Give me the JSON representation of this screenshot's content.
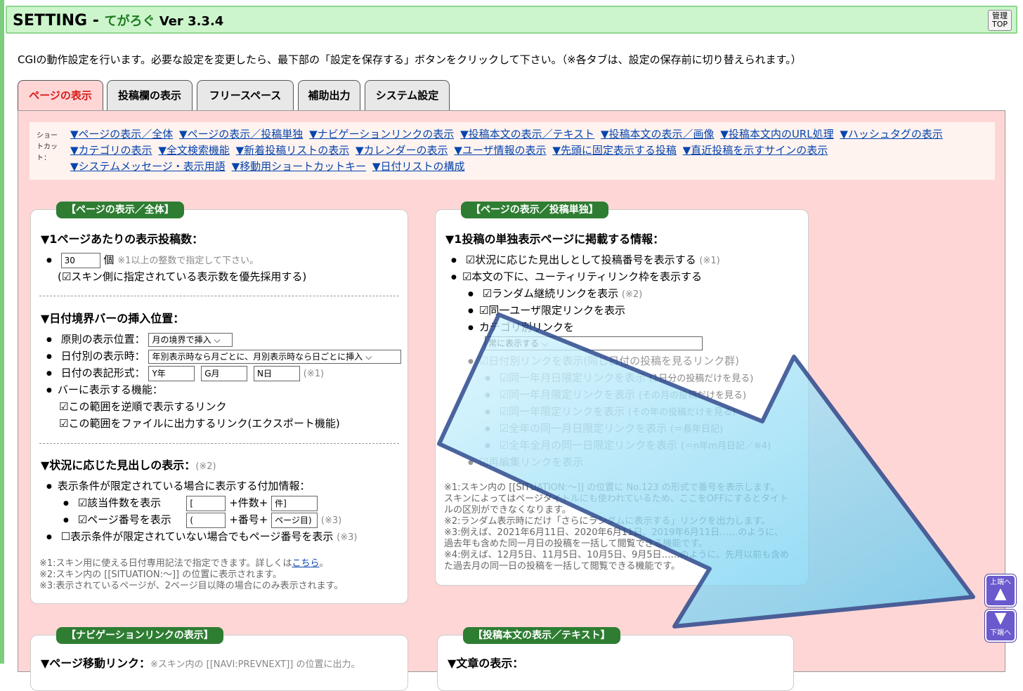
{
  "header": {
    "title_main": "SETTING - ",
    "title_app": "てがろぐ",
    "title_ver": " Ver 3.3.4",
    "admin_btn_line1": "管理",
    "admin_btn_line2": "TOP"
  },
  "intro": "CGIの動作設定を行います。必要な設定を変更したら、最下部の「設定を保存する」ボタンをクリックして下さい。（※各タブは、設定の保存前に切り替えられます。）",
  "tabs": [
    "ページの表示",
    "投稿欄の表示",
    "フリースペース",
    "補助出力",
    "システム設定"
  ],
  "shortcut": {
    "label": "ショートカット：",
    "links": [
      "▼ページの表示／全体",
      "▼ページの表示／投稿単独",
      "▼ナビゲーションリンクの表示",
      "▼投稿本文の表示／テキスト",
      "▼投稿本文の表示／画像",
      "▼投稿本文内のURL処理",
      "▼ハッシュタグの表示",
      "▼カテゴリの表示",
      "▼全文検索機能",
      "▼新着投稿リストの表示",
      "▼カレンダーの表示",
      "▼ユーザ情報の表示",
      "▼先頭に固定表示する投稿",
      "▼直近投稿を示すサインの表示",
      "▼システムメッセージ・表示用語",
      "▼移動用ショートカットキー",
      "▼日付リストの構成"
    ]
  },
  "box1": {
    "title": "【ページの表示／全体】",
    "s1_head": "▼1ページあたりの表示投稿数：",
    "s1_value": "30",
    "s1_unit": "個",
    "s1_note": "※1以上の整数で指定して下さい。",
    "s1_opt": "(☑スキン側に指定されている表示数を優先採用する)",
    "s2_head": "▼日付境界バーの挿入位置：",
    "s2_r1_label": "原則の表示位置：",
    "s2_r1_select": "月の境界で挿入",
    "s2_r2_label": "日付別の表示時：",
    "s2_r2_select": "年別表示時なら月ごとに、月別表示時なら日ごとに挿入",
    "s2_r3_label": "日付の表記形式：",
    "s2_r3_v1": "Y年",
    "s2_r3_v2": "G月",
    "s2_r3_v3": "N日",
    "s2_r3_note": "(※1)",
    "s2_r4_label": "バーに表示する機能：",
    "s2_r4_c1": "☑この範囲を逆順で表示するリンク",
    "s2_r4_c2": "☑この範囲をファイルに出力するリンク(エクスポート機能)",
    "s3_head": "▼状況に応じた見出しの表示：",
    "s3_head_note": "(※2)",
    "s3_r1": "表示条件が限定されている場合に表示する付加情報：",
    "s3_r2_label": "☑該当件数を表示",
    "s3_r2_v1": "[",
    "s3_r2_mid": "+件数+",
    "s3_r2_v2": "件]",
    "s3_r3_label": "☑ページ番号を表示",
    "s3_r3_v1": "(",
    "s3_r3_mid": "+番号+",
    "s3_r3_v2": "ページ目)",
    "s3_r3_note": "(※3)",
    "s3_r4": "☐表示条件が限定されていない場合でもページ番号を表示",
    "s3_r4_note": "(※3)",
    "foot1_pre": "※1:スキン用に使える日付専用記法で指定できます。詳しくは",
    "foot1_link": "こちら",
    "foot1_post": "。",
    "foot2": "※2:スキン内の [[SITUATION:～]] の位置に表示されます。",
    "foot3": "※3:表示されているページが、2ページ目以降の場合にのみ表示されます。"
  },
  "box2": {
    "title": "【ページの表示／投稿単独】",
    "head": "▼1投稿の単独表示ページに掲載する情報：",
    "r1": "☑状況に応じた見出しとして投稿番号を表示する",
    "r1_note": "(※1)",
    "r2": "☑本文の下に、ユーティリティリンク枠を表示する",
    "r3": "☑ランダム継続リンクを表示",
    "r3_note": "(※2)",
    "r4": "☑同一ユーザ限定リンクを表示",
    "r5": "カテゴリ別リンクを",
    "r5_select": "常に表示する",
    "r6": "☑日付別リンクを表示(同じ日付の投稿を見るリンク群)",
    "r7": "☑同一年月日限定リンクを表示",
    "r7_note": "(1日分の投稿だけを見る)",
    "r8": "☑同一年月限定リンクを表示",
    "r8_note": "(その月の投稿だけを見る)",
    "r9": "☑同一年限定リンクを表示",
    "r9_note": "(その年の投稿だけを見る)",
    "r10": "☑全年の同一月日限定リンクを表示",
    "r10_note": "(＝長年日記)",
    "r11": "☑全年全月の同一日限定リンクを表示",
    "r11_note": "(＝n年m月日記／※4)",
    "r12": "☑再編集リンクを表示",
    "foot1": "※1:スキン内の [[SITUATION:～]] の位置に No.123 の形式で番号を表示します。",
    "foot1b": "スキンによってはページタイトルにも使われているため、ここをOFFにするとタイト",
    "foot1c": "ルの区別ができなくなります。",
    "foot2": "※2:ランダム表示時にだけ「さらにランダムに表示する」リンクを出力します。",
    "foot3": "※3:例えば、2021年6月11日、2020年6月11日、2019年6月11日……のように、",
    "foot3b": "過去年も含めた同一月日の投稿を一括して閲覧できる機能です。",
    "foot4": "※4:例えば、12月5日、11月5日、10月5日、9月5日……のように、先月以前も含め",
    "foot4b": "た過去月の同一日の投稿を一括して閲覧できる機能です。"
  },
  "box3": {
    "title": "【ナビゲーションリンクの表示】",
    "head": "▼ページ移動リンク：",
    "head_note": "※スキン内の [[NAVI:PREVNEXT]] の位置に出力。"
  },
  "box4": {
    "title": "【投稿本文の表示／テキスト】",
    "head": "▼文章の表示："
  },
  "nav": {
    "up_label": "上端へ",
    "down_label": "下端へ"
  },
  "colors": {
    "header_bg": "#ccf5cc",
    "panel_bg": "#ffd6d6",
    "box_title_bg": "#2e7d32",
    "active_tab_text": "#d81b1b",
    "link": "#0645ad",
    "nav_btn": "#6a5acd"
  }
}
